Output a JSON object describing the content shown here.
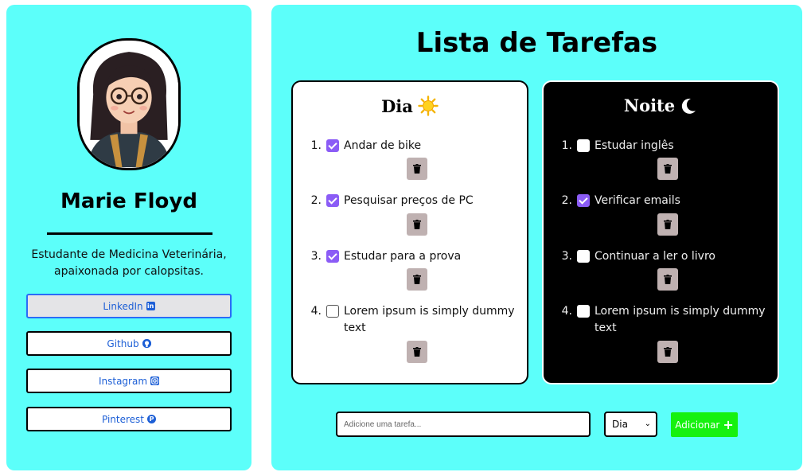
{
  "profile": {
    "name": "Marie Floyd",
    "bio_line1": "Estudante de Medicina Veterinária,",
    "bio_line2": "apaixonada por calopsitas.",
    "links": [
      {
        "label": "LinkedIn",
        "icon": "linkedin-icon"
      },
      {
        "label": "Github",
        "icon": "github-icon"
      },
      {
        "label": "Instagram",
        "icon": "instagram-icon"
      },
      {
        "label": "Pinterest",
        "icon": "pinterest-icon"
      }
    ]
  },
  "main": {
    "title": "Lista de Tarefas",
    "day": {
      "title": "Dia",
      "icon": "sun-icon",
      "tasks": [
        {
          "num": "1.",
          "text": "Andar de bike",
          "checked": true
        },
        {
          "num": "2.",
          "text": "Pesquisar preços de PC",
          "checked": true
        },
        {
          "num": "3.",
          "text": "Estudar para a prova",
          "checked": true
        },
        {
          "num": "4.",
          "text": "Lorem ipsum is simply dummy text",
          "checked": false
        }
      ]
    },
    "night": {
      "title": "Noite",
      "icon": "moon-icon",
      "tasks": [
        {
          "num": "1.",
          "text": "Estudar inglês",
          "checked": false
        },
        {
          "num": "2.",
          "text": "Verificar emails",
          "checked": true
        },
        {
          "num": "3.",
          "text": "Continuar a ler o livro",
          "checked": false
        },
        {
          "num": "4.",
          "text": "Lorem ipsum is simply dummy text",
          "checked": false
        }
      ]
    }
  },
  "form": {
    "placeholder": "Adicione uma tarefa...",
    "selected_period": "Dia",
    "add_label": "Adicionar"
  },
  "colors": {
    "panel": "#5cfffa",
    "checkbox": "#8b5cf6",
    "add_button": "#16f10f",
    "link_text": "#1d5fd6",
    "trash_button": "#bfb1b1"
  }
}
